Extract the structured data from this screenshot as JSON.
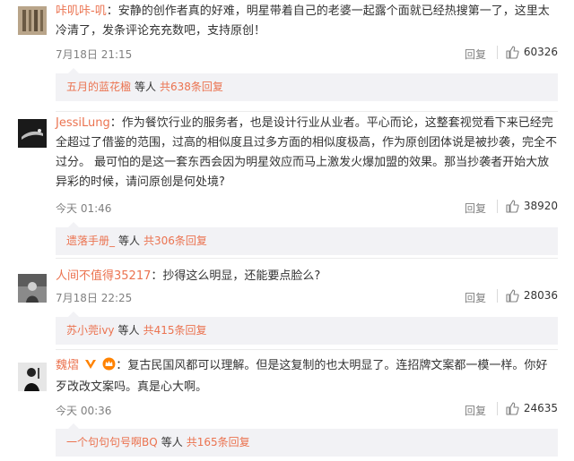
{
  "comments": [
    {
      "username": "咔叽咔-叽",
      "text": "安静的创作者真的好难，明星带着自己的老婆一起露个面就已经热搜第一了，这里太冷清了，发条评论充充数吧，支持原创！",
      "time": "7月18日 21:15",
      "reply_label": "回复",
      "likes": "60326",
      "sub": {
        "user": "五月的蓝花楹",
        "etc": "等人",
        "total": "共638条回复"
      }
    },
    {
      "username": "JessiLung",
      "text": "作为餐饮行业的服务者，也是设计行业从业者。平心而论，这整套视觉看下来已经完全超过了借鉴的范围，过高的相似度且过多方面的相似度极高，作为原创团体说是被抄袭，完全不过分。 最可怕的是这一套东西会因为明星效应而马上激发火爆加盟的效果。那当抄袭者开始大放异彩的时候，请问原创是何处境?",
      "time": "今天 01:46",
      "reply_label": "回复",
      "likes": "38920",
      "sub": {
        "user": "遗落手册_",
        "etc": "等人",
        "total": "共306条回复"
      }
    },
    {
      "username": "人间不值得35217",
      "text": "抄得这么明显，还能要点脸么?",
      "time": "7月18日 22:25",
      "reply_label": "回复",
      "likes": "28036",
      "sub": {
        "user": "苏小莞ivy",
        "etc": "等人",
        "total": "共415条回复"
      }
    },
    {
      "username": "魏熠",
      "text": "复古民国风都可以理解。但是这复制的也太明显了。连招牌文案都一模一样。你好歹改改文案吗。真是心大啊。",
      "time": "今天 00:36",
      "reply_label": "回复",
      "likes": "24635",
      "sub": {
        "user": "一个句句句号啊BQ",
        "etc": "等人",
        "total": "共165条回复"
      }
    }
  ],
  "icons": {
    "like": "thumbs-up-icon",
    "verified": "verified-v-icon",
    "vip": "vip-crown-icon"
  },
  "colors": {
    "username": "#eb7350",
    "meta": "#808080",
    "subreply_bg": "#f2f2f5",
    "badge": "#ff8200"
  }
}
